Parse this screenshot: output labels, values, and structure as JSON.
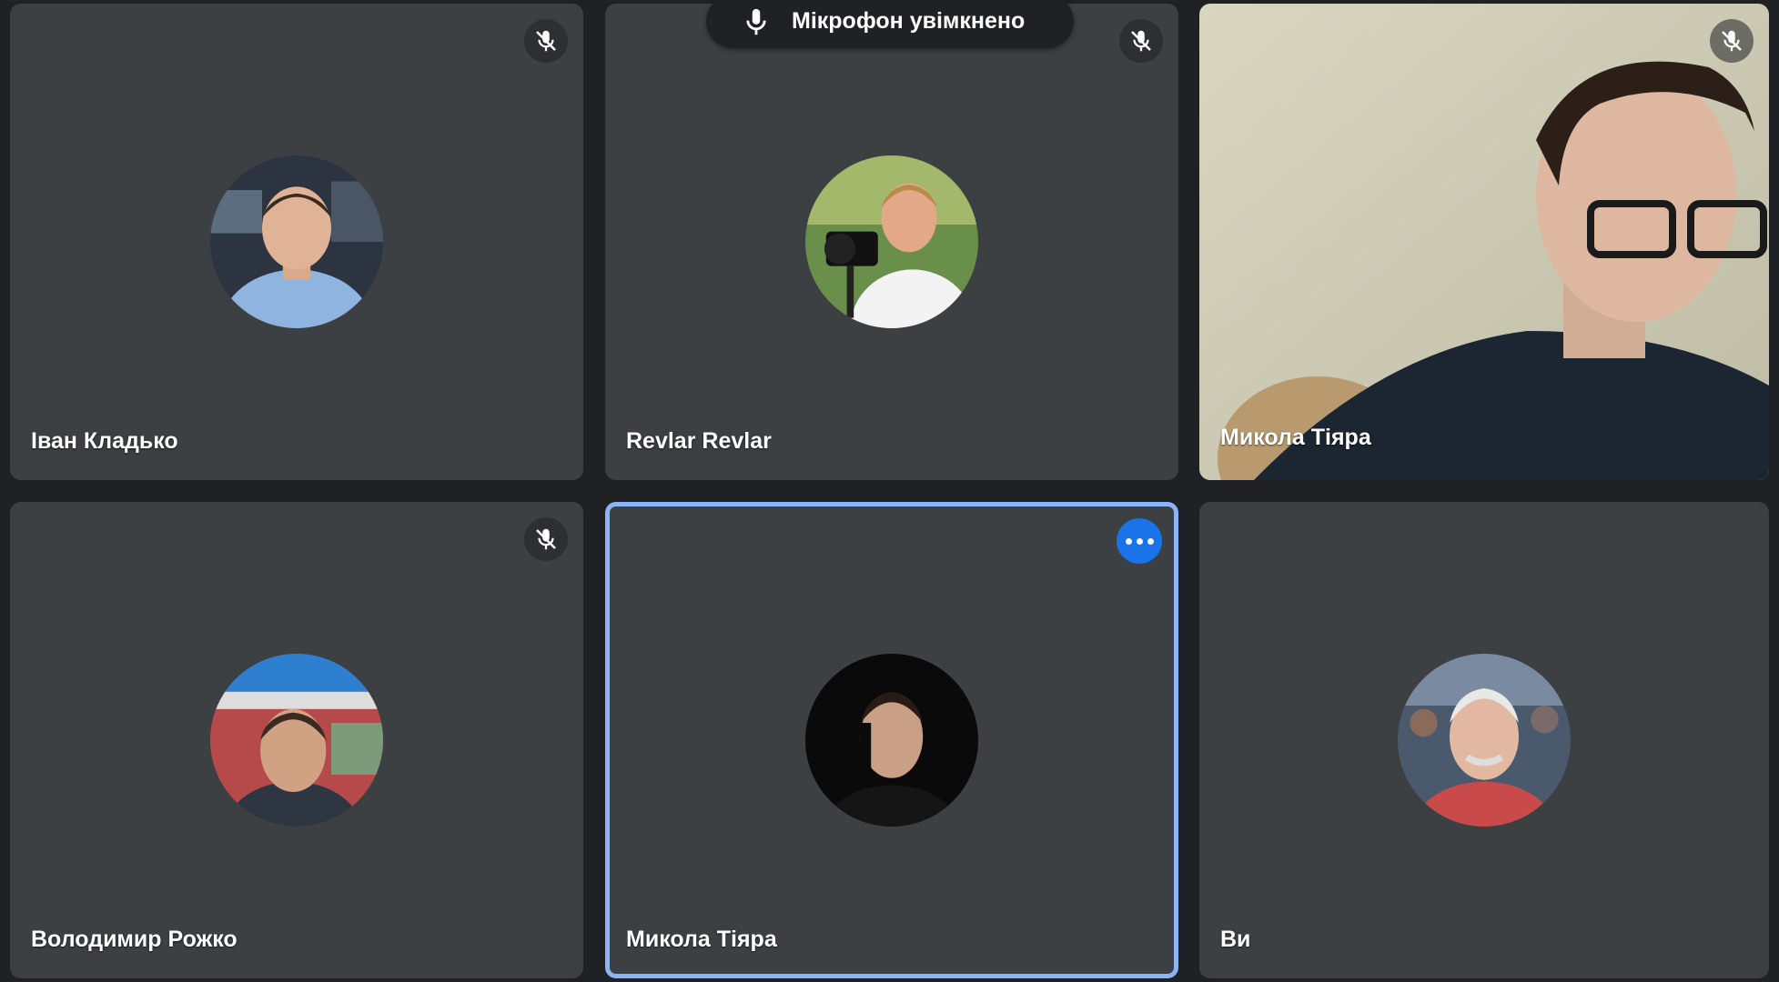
{
  "toast": {
    "text": "Мікрофон увімкнено",
    "icon": "microphone-icon"
  },
  "participants": [
    {
      "name": "Іван Кладько",
      "muted": true,
      "mode": "avatar"
    },
    {
      "name": "Revlar Revlar",
      "muted": true,
      "mode": "avatar"
    },
    {
      "name": "Микола Тіяра",
      "muted": true,
      "mode": "video"
    },
    {
      "name": "Володимир Рожко",
      "muted": true,
      "mode": "avatar"
    },
    {
      "name": "Микола Тіяра",
      "muted": false,
      "mode": "avatar",
      "active": true,
      "menu_icon": "more-options-icon"
    },
    {
      "name": "Ви",
      "muted": false,
      "mode": "avatar"
    }
  ],
  "colors": {
    "background": "#202124",
    "tile": "#3c4043",
    "active_border": "#8ab4f8",
    "menu_button": "#1a73e8"
  }
}
